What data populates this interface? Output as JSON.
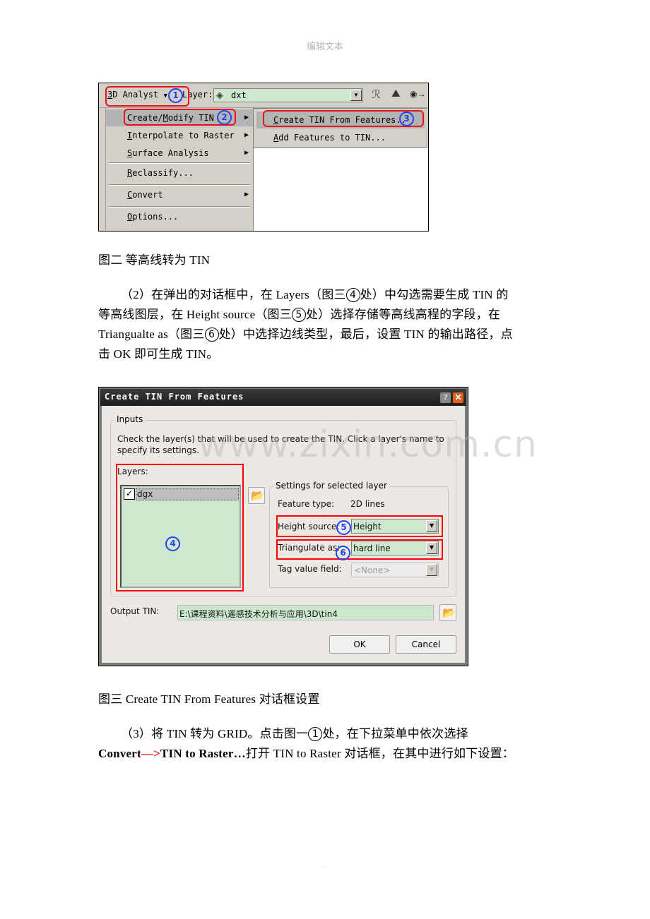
{
  "page_header": "编辑文本",
  "figure2": {
    "toolbar": {
      "menu_button": "3D Analyst",
      "menu_button_hotkey": "3",
      "menu_button_rest": "D Analyst",
      "layer_label": "Layer:",
      "layer_value": "dxt",
      "icons": [
        "contour-tool-icon",
        "line-of-sight-icon",
        "steepest-path-icon"
      ]
    },
    "menu": {
      "items": [
        {
          "label": "Create/Modify TIN",
          "pre": "Create/",
          "hot": "M",
          "post": "odify TIN",
          "submenu": true,
          "selected": true
        },
        {
          "label": "Interpolate to Raster",
          "pre": "",
          "hot": "I",
          "post": "nterpolate to Raster",
          "submenu": true
        },
        {
          "label": "Surface Analysis",
          "pre": "",
          "hot": "S",
          "post": "urface Analysis",
          "submenu": true
        },
        {
          "label": "Reclassify...",
          "pre": "",
          "hot": "R",
          "post": "eclassify...",
          "submenu": false
        },
        {
          "label": "Convert",
          "pre": "",
          "hot": "C",
          "post": "onvert",
          "submenu": true
        },
        {
          "label": "Options...",
          "pre": "",
          "hot": "O",
          "post": "ptions...",
          "submenu": false
        }
      ]
    },
    "submenu": {
      "items": [
        {
          "label": "Create TIN From Features...",
          "hot": "C",
          "post": "reate TIN From Features..",
          "selected": true
        },
        {
          "label": "Add Features to TIN...",
          "hot": "A",
          "post": "dd Features to TIN...",
          "selected": false
        }
      ]
    },
    "markers": [
      "1",
      "2",
      "3"
    ],
    "caption": "图二 等高线转为 TIN"
  },
  "paragraph2": {
    "line1_a": "（2）在弹出的对话框中，在 Layers（图三",
    "line1_m": "4",
    "line1_b": "处）中勾选需要生成 TIN 的",
    "line2_a": "等高线图层，在 Height source（图三",
    "line2_m": "5",
    "line2_b": "处）选择存储等高线高程的字段，在",
    "line3_a": "Triangualte as（图三",
    "line3_m": "6",
    "line3_b": "处）中选择边线类型，最后，设置 TIN 的输出路径，点",
    "line4": "击 OK 即可生成 TIN。"
  },
  "figure3": {
    "title": "Create TIN From Features",
    "help_label": "?",
    "close_label": "✕",
    "inputs_group": "Inputs",
    "instructions_1": "Check the layer(s) that will be used to create the TIN.  Click a layer's name to",
    "instructions_2": "specify its settings.",
    "layers_label": "Layers:",
    "layers": [
      {
        "name": "dgx",
        "checked": true
      }
    ],
    "settings_group": "Settings for selected layer",
    "feature_type_label": "Feature type:",
    "feature_type_value": "2D lines",
    "height_source_label": "Height source:",
    "height_source_value": "Height",
    "triangulate_label": "Triangulate as:",
    "triangulate_value": "hard line",
    "tag_value_label": "Tag value field:",
    "tag_value_value": "<None>",
    "output_label": "Output TIN:",
    "output_value": "E:\\课程资料\\遥感技术分析与应用\\3D\\tin4",
    "ok_label": "OK",
    "cancel_label": "Cancel",
    "markers": [
      "4",
      "5",
      "6"
    ],
    "watermark": "www.zixin.com.cn",
    "caption": "图三 Create TIN From Features 对话框设置"
  },
  "paragraph3": {
    "line1_a": "（3）将 TIN 转为 GRID。点击图一",
    "line1_m": "1",
    "line1_b": "处，在下拉菜单中依次选择",
    "line2_bold1": "Convert",
    "line2_arrow": "—>",
    "line2_bold2": "TIN to Raster…",
    "line2_rest": "打开 TIN to Raster 对话框，在其中进行如下设置："
  },
  "footer_mark": "."
}
